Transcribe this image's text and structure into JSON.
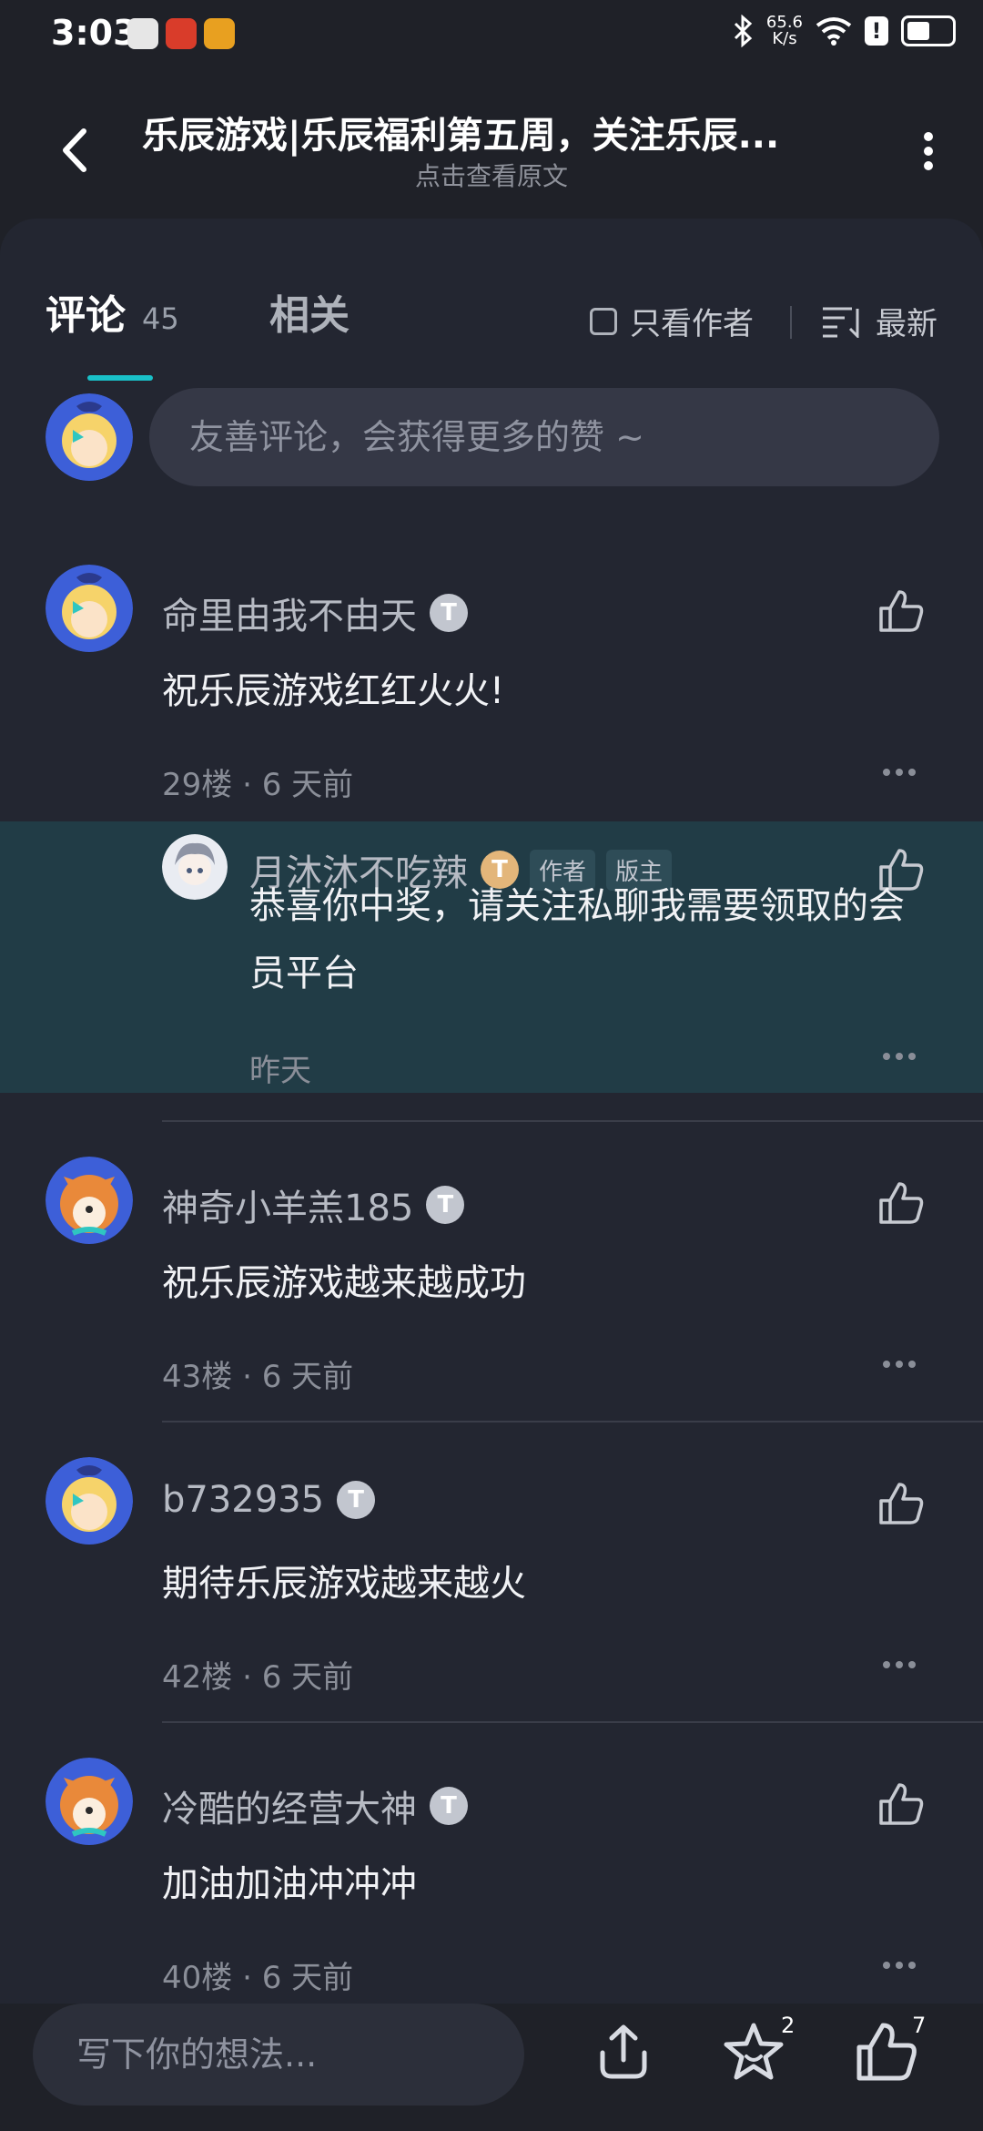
{
  "status": {
    "time": "3:03",
    "net_speed": "65.6",
    "net_unit": "K/s"
  },
  "header": {
    "title": "乐辰游戏|乐辰福利第五周，关注乐辰...",
    "subtitle": "点击查看原文"
  },
  "tabs": {
    "comments_label": "评论",
    "comments_count": "45",
    "related_label": "相关",
    "author_only_label": "只看作者",
    "sort_label": "最新"
  },
  "comment_input": {
    "placeholder": "友善评论，会获得更多的赞 ~"
  },
  "comments": [
    {
      "name": "命里由我不由天",
      "badge": "T",
      "text": "祝乐辰游戏红红火火!",
      "floor": "29楼",
      "time": "6 天前",
      "avatar": "blonde-girl"
    },
    {
      "name": "神奇小羊羔185",
      "badge": "T",
      "text": "祝乐辰游戏越来越成功",
      "floor": "43楼",
      "time": "6 天前",
      "avatar": "shiba"
    },
    {
      "name": "b732935",
      "badge": "T",
      "text": "期待乐辰游戏越来越火",
      "floor": "42楼",
      "time": "6 天前",
      "avatar": "blonde-girl"
    },
    {
      "name": "冷酷的经营大神",
      "badge": "T",
      "text": "加油加油冲冲冲",
      "floor": "40楼",
      "time": "6 天前",
      "avatar": "shiba"
    }
  ],
  "reply": {
    "name": "月沐沐不吃辣",
    "badge": "T",
    "tag_author": "作者",
    "tag_mod": "版主",
    "text": "恭喜你中奖，请关注私聊我需要领取的会员平台",
    "time": "昨天"
  },
  "meta_separator": "·",
  "bottom": {
    "write_placeholder": "写下你的想法...",
    "favorite_count": "2",
    "like_count": "7"
  },
  "colors": {
    "background": "#1f2128",
    "panel": "#232631",
    "accent": "#19c0c8",
    "reply_highlight": "#213c46"
  },
  "icons": [
    "back-icon",
    "more-vertical-icon",
    "sort-icon",
    "like-icon",
    "more-horizontal-icon",
    "share-icon",
    "star-icon"
  ]
}
